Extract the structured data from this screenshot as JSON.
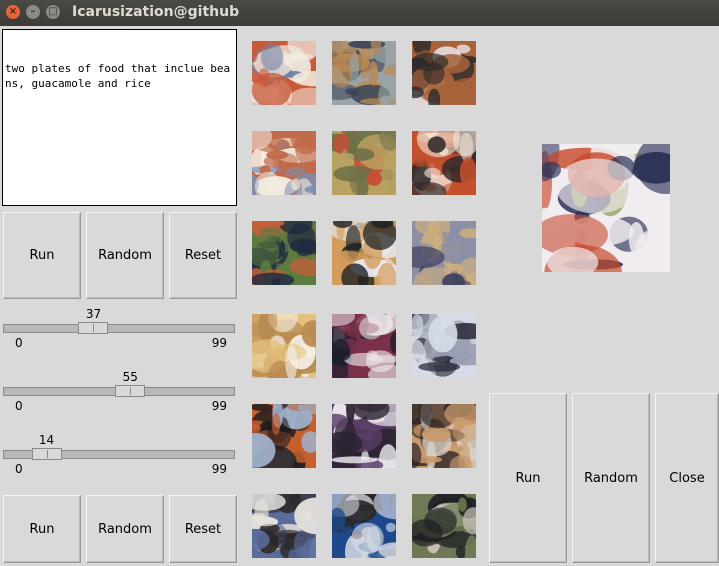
{
  "window": {
    "title": "Icarusization@github",
    "controls": [
      "close",
      "minimize",
      "maximize"
    ]
  },
  "caption_text": "two plates of food that inclue beans, guacamole and rice",
  "left_panel": {
    "top_buttons": [
      "Run",
      "Random",
      "Reset"
    ],
    "sliders": [
      {
        "value": "37",
        "min": "0",
        "max": "99",
        "level": 0.3737
      },
      {
        "value": "55",
        "min": "0",
        "max": "99",
        "level": 0.5556
      },
      {
        "value": "14",
        "min": "0",
        "max": "99",
        "level": 0.1414
      }
    ],
    "bottom_buttons": [
      "Run",
      "Random",
      "Reset"
    ]
  },
  "right_panel": {
    "buttons": [
      "Run",
      "Random",
      "Close"
    ]
  },
  "thumbnails": [
    {
      "c1": "#c85a3a",
      "c2": "#6f7fa8",
      "c3": "#f2e9dc"
    },
    {
      "c1": "#9aa4a6",
      "c2": "#b98a55",
      "c3": "#3a4458"
    },
    {
      "c1": "#a7623a",
      "c2": "#2d2a2c",
      "c3": "#e7e4e9"
    },
    {
      "c1": "#c26a4a",
      "c2": "#7c8fb0",
      "c3": "#f3eee3"
    },
    {
      "c1": "#b8a262",
      "c2": "#6e7048",
      "c3": "#c94d33"
    },
    {
      "c1": "#c5502e",
      "c2": "#2f2a2a",
      "c3": "#f2e6d7"
    },
    {
      "c1": "#5c7b3f",
      "c2": "#c55f3b",
      "c3": "#1e2940"
    },
    {
      "c1": "#d39c5a",
      "c2": "#1f2225",
      "c3": "#e8eaf0"
    },
    {
      "c1": "#8c8fa5",
      "c2": "#d0b07e",
      "c3": "#3d3f5e"
    },
    {
      "c1": "#e3c07c",
      "c2": "#b98a52",
      "c3": "#f5efe4"
    },
    {
      "c1": "#7a2f4a",
      "c2": "#e9e2e7",
      "c3": "#1d1f2f"
    },
    {
      "c1": "#d6dce6",
      "c2": "#2a2a3a",
      "c3": "#9aa0b4"
    },
    {
      "c1": "#c65f2e",
      "c2": "#1f1c1f",
      "c3": "#9fb0c9"
    },
    {
      "c1": "#5b3e6a",
      "c2": "#f0eef2",
      "c3": "#2b2330"
    },
    {
      "c1": "#c99a6c",
      "c2": "#2a2223",
      "c3": "#d9d3cc"
    },
    {
      "c1": "#5a6c9c",
      "c2": "#2b2626",
      "c3": "#e6e2dc"
    },
    {
      "c1": "#1e4a8c",
      "c2": "#d9dbe6",
      "c3": "#2a2628"
    },
    {
      "c1": "#6d7a55",
      "c2": "#1f2024",
      "c3": "#d2c9c0"
    }
  ],
  "preview": {
    "c1": "#8fa05a",
    "c2": "#c74a2e",
    "c3": "#f0ecef",
    "c4": "#2a2f55"
  }
}
